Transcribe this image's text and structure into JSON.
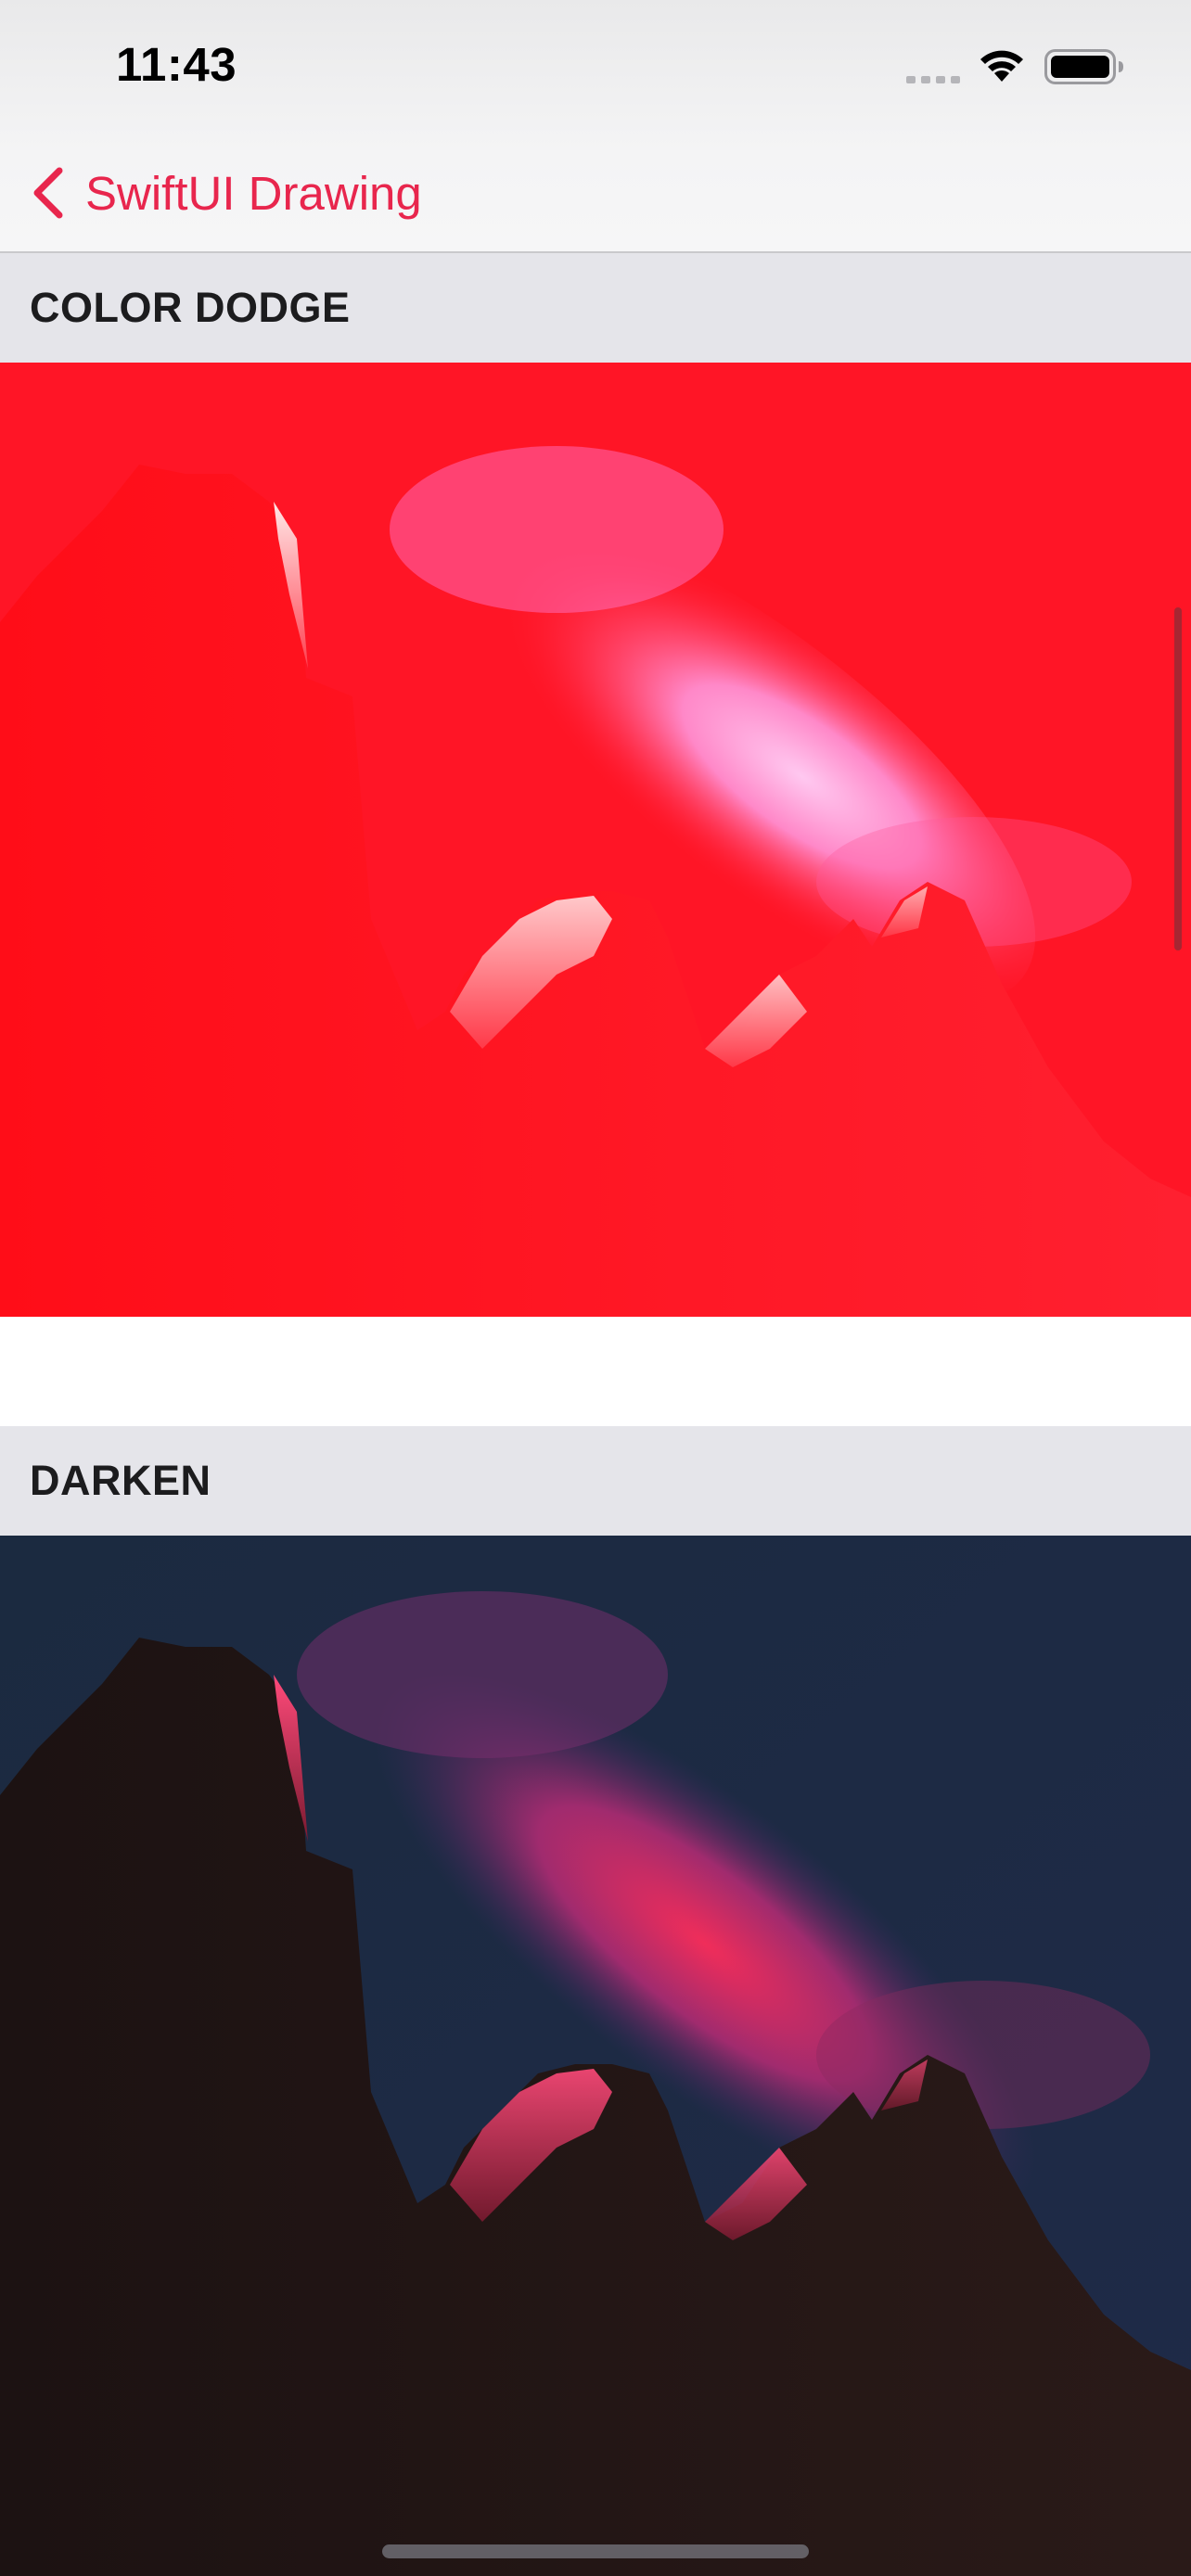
{
  "status_bar": {
    "time": "11:43",
    "icons": [
      "cellular-signal-icon",
      "wifi-icon",
      "battery-icon"
    ]
  },
  "nav_bar": {
    "back_label": "SwiftUI Drawing",
    "back_icon": "chevron-left-icon",
    "tint_color": "#e8264d"
  },
  "sections": [
    {
      "title": "COLOR DODGE",
      "image": "night-sky-rock-formation-photo",
      "blend_color": "#ff1020"
    },
    {
      "title": "DARKEN",
      "image": "night-sky-rock-formation-photo",
      "blend_color": "#ff2a55"
    }
  ]
}
